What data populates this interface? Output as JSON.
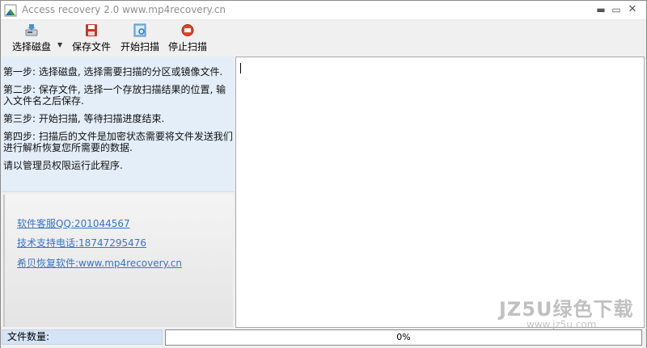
{
  "window": {
    "title": "Access recovery 2.0    www.mp4recovery.cn",
    "controls": {
      "minimize": "▬",
      "maximize": "▭",
      "close": "✕"
    }
  },
  "toolbar": {
    "select_disk": "选择磁盘",
    "save_file": "保存文件",
    "start_scan": "开始扫描",
    "stop_scan": "停止扫描",
    "icons": {
      "select_disk": "disk-icon",
      "save_file": "save-icon",
      "start_scan": "scan-icon",
      "stop_scan": "stop-icon"
    }
  },
  "instructions": [
    "第一步: 选择磁盘, 选择需要扫描的分区或镜像文件.",
    "第二步: 保存文件, 选择一个存放扫描结果的位置, 输入文件名之后保存.",
    "第三步: 开始扫描, 等待扫描进度结束.",
    "第四步: 扫描后的文件是加密状态需要将文件发送我们进行解析恢复您所需要的数据.",
    "请以管理员权限运行此程序."
  ],
  "links": {
    "qq": "软件客服QQ:201044567",
    "phone": "技术支持电话:18747295476",
    "site": "希贝恢复软件:www.mp4recovery.cn"
  },
  "statusbar": {
    "file_count_label": "文件数量:",
    "progress_text": "0%",
    "progress_value": 0
  },
  "watermark": {
    "main": "JZ5U绿色下载",
    "sub": "www.jz5u.com"
  },
  "colors": {
    "instructions_bg": "#e3eef9",
    "link": "#3a73c9",
    "progress": "#3c9b3c"
  }
}
